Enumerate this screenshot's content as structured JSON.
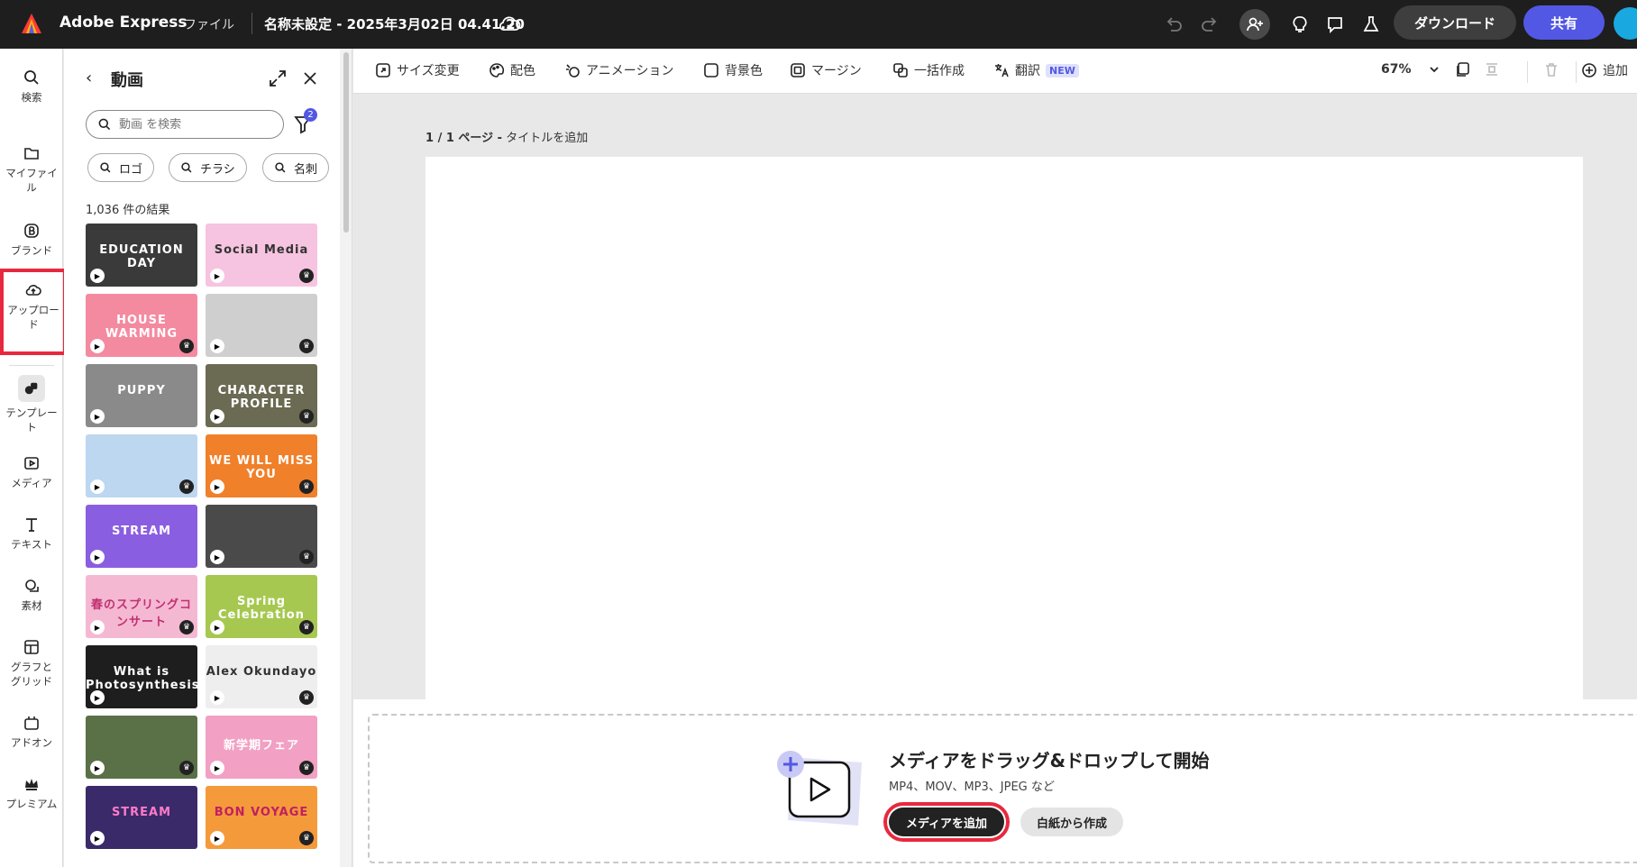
{
  "topbar": {
    "app_name": "Adobe Express",
    "file_menu": "ファイル",
    "doc_title": "名称未設定 - 2025年3月02日 04.41.20",
    "download_label": "ダウンロード",
    "share_label": "共有"
  },
  "rail": {
    "search": "検索",
    "myfiles": "マイファイル",
    "brand": "ブランド",
    "upload": "アップロード",
    "templates": "テンプレート",
    "media": "メディア",
    "text": "テキスト",
    "elements": "素材",
    "grids": "グラフとグリッド",
    "addons": "アドオン",
    "premium": "プレミアム"
  },
  "panel": {
    "title": "動画",
    "search_placeholder": "動画 を検索",
    "filter_count": "2",
    "chips": [
      "ロゴ",
      "チラシ",
      "名刺"
    ],
    "results": "1,036 件の結果",
    "thumbs": [
      {
        "caption": "EDUCATION DAY",
        "bg": "#3a3a3a",
        "fg": "#ffffff",
        "premium": false
      },
      {
        "caption": "Social Media",
        "bg": "#f6c4e0",
        "fg": "#333333",
        "premium": true
      },
      {
        "caption": "HOUSE WARMING",
        "bg": "#f48aa0",
        "fg": "#ffffff",
        "premium": true
      },
      {
        "caption": "",
        "bg": "#cfcfcf",
        "fg": "#222222",
        "premium": true
      },
      {
        "caption": "PUPPY",
        "bg": "#8a8a8a",
        "fg": "#ffffff",
        "premium": false
      },
      {
        "caption": "CHARACTER PROFILE",
        "bg": "#6b6a52",
        "fg": "#ffffff",
        "premium": true
      },
      {
        "caption": "",
        "bg": "#bcd7ef",
        "fg": "#222222",
        "premium": true
      },
      {
        "caption": "WE WILL MISS YOU",
        "bg": "#f0802a",
        "fg": "#ffffff",
        "premium": true
      },
      {
        "caption": "STREAM",
        "bg": "#8a5ee0",
        "fg": "#ffffff",
        "premium": false
      },
      {
        "caption": "",
        "bg": "#4a4a4a",
        "fg": "#ffffff",
        "premium": true
      },
      {
        "caption": "春のスプリングコンサート",
        "bg": "#f5b8d2",
        "fg": "#c03070",
        "premium": true
      },
      {
        "caption": "Spring Celebration",
        "bg": "#a6c850",
        "fg": "#ffffff",
        "premium": true
      },
      {
        "caption": "What is Photosynthesis?",
        "bg": "#1e1e1e",
        "fg": "#ffffff",
        "premium": false
      },
      {
        "caption": "Alex Okundayo",
        "bg": "#eeeeee",
        "fg": "#333333",
        "premium": true
      },
      {
        "caption": "",
        "bg": "#5a7046",
        "fg": "#ffffff",
        "premium": true
      },
      {
        "caption": "新学期フェア",
        "bg": "#f2a0c4",
        "fg": "#ffffff",
        "premium": true
      },
      {
        "caption": "STREAM",
        "bg": "#3a2a6a",
        "fg": "#ff7ac8",
        "premium": false
      },
      {
        "caption": "BON VOYAGE",
        "bg": "#f59a3a",
        "fg": "#c02060",
        "premium": true
      }
    ]
  },
  "toolbar": {
    "resize": "サイズ変更",
    "colors": "配色",
    "animation": "アニメーション",
    "background": "背景色",
    "margin": "マージン",
    "bulk": "一括作成",
    "translate": "翻訳",
    "new_badge": "NEW",
    "zoom": "67%",
    "add": "追加"
  },
  "canvas": {
    "page_counter": "1 / 1 ページ -",
    "add_title": "タイトルを追加"
  },
  "dropzone": {
    "title": "メディアをドラッグ&ドロップして開始",
    "subtitle": "MP4、MOV、MP3、JPEG など",
    "add_media": "メディアを追加",
    "blank": "白紙から作成"
  }
}
